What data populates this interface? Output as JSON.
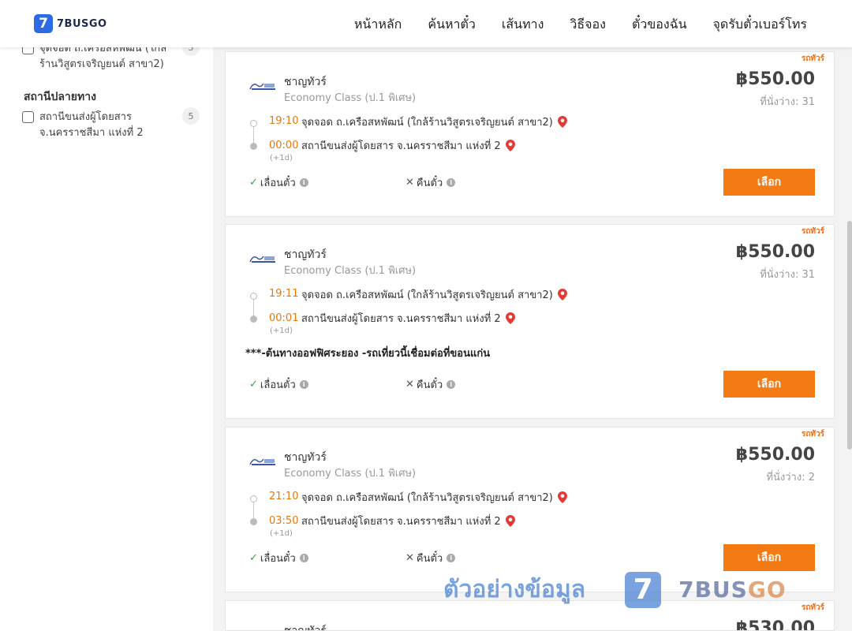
{
  "header": {
    "logo_mark": "7",
    "logo_text": "7BUSGO",
    "nav": [
      "หน้าหลัก",
      "ค้นหาตั๋ว",
      "เส้นทาง",
      "วิธีจอง",
      "ตั๋วของฉัน",
      "จุดรับตั๋วเบอร์โทร"
    ]
  },
  "sidebar": {
    "origin_filter": {
      "label": "จุดจอด ถ.เครือสหพัฒน์ (ใกล้ร้านวิสูตรเจริญยนต์ สาขา2)",
      "count": "5"
    },
    "destination_title": "สถานีปลายทาง",
    "destination_filter": {
      "label": "สถานีขนส่งผู้โดยสาร จ.นครราชสีมา แห่งที่ 2",
      "count": "5"
    }
  },
  "trips": [
    {
      "badge": "รถทัวร์",
      "operator": "ชาญทัวร์",
      "class": "Economy Class (ป.1 พิเศษ)",
      "price": "฿550.00",
      "seats": "ที่นั่งว่าง: 31",
      "depart_time": "19:10",
      "depart_stop": "จุดจอด ถ.เครือสหพัฒน์ (ใกล้ร้านวิสูตรเจริญยนต์ สาขา2)",
      "arrive_time": "00:00",
      "arrive_stop": "สถานีขนส่งผู้โดยสาร จ.นครราชสีมา แห่งที่ 2",
      "day_offset": "(+1d)",
      "note": "",
      "reschedule": "เลื่อนตั๋ว",
      "refund": "คืนตั๋ว",
      "select": "เลือก"
    },
    {
      "badge": "รถทัวร์",
      "operator": "ชาญทัวร์",
      "class": "Economy Class (ป.1 พิเศษ)",
      "price": "฿550.00",
      "seats": "ที่นั่งว่าง: 31",
      "depart_time": "19:11",
      "depart_stop": "จุดจอด ถ.เครือสหพัฒน์ (ใกล้ร้านวิสูตรเจริญยนต์ สาขา2)",
      "arrive_time": "00:01",
      "arrive_stop": "สถานีขนส่งผู้โดยสาร จ.นครราชสีมา แห่งที่ 2",
      "day_offset": "(+1d)",
      "note": "***-ต้นทางออฟฟิศระยอง -รถเที่ยวนี้เชื่อมต่อที่ขอนแก่น",
      "reschedule": "เลื่อนตั๋ว",
      "refund": "คืนตั๋ว",
      "select": "เลือก"
    },
    {
      "badge": "รถทัวร์",
      "operator": "ชาญทัวร์",
      "class": "Economy Class (ป.1 พิเศษ)",
      "price": "฿550.00",
      "seats": "ที่นั่งว่าง: 2",
      "depart_time": "21:10",
      "depart_stop": "จุดจอด ถ.เครือสหพัฒน์ (ใกล้ร้านวิสูตรเจริญยนต์ สาขา2)",
      "arrive_time": "03:50",
      "arrive_stop": "สถานีขนส่งผู้โดยสาร จ.นครราชสีมา แห่งที่ 2",
      "day_offset": "(+1d)",
      "note": "",
      "reschedule": "เลื่อนตั๋ว",
      "refund": "คืนตั๋ว",
      "select": "เลือก"
    },
    {
      "badge": "รถทัวร์",
      "operator": "ชาญทัวร์",
      "price": "฿530.00"
    }
  ],
  "watermark": {
    "text": "ตัวอย่างข้อมูล",
    "logo_mark": "7",
    "brand_main": "7BUS",
    "brand_go": "GO"
  },
  "colors": {
    "accent_orange": "#f47b14",
    "time_orange": "#e6780b",
    "brand_blue": "#2d6be4",
    "pin_red": "#e53935",
    "check_green": "#2ea043"
  }
}
